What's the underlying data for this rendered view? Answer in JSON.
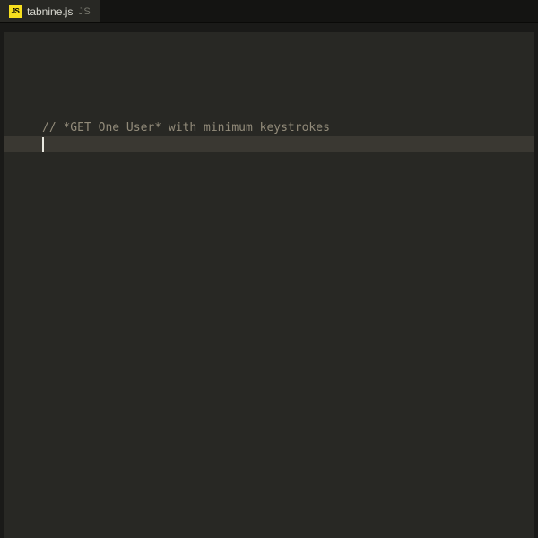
{
  "tab": {
    "icon_text": "JS",
    "filename": "tabnine.js",
    "language_badge": "JS"
  },
  "editor": {
    "comment_line": "// *GET One User* with minimum keystrokes",
    "current_line_content": ""
  }
}
